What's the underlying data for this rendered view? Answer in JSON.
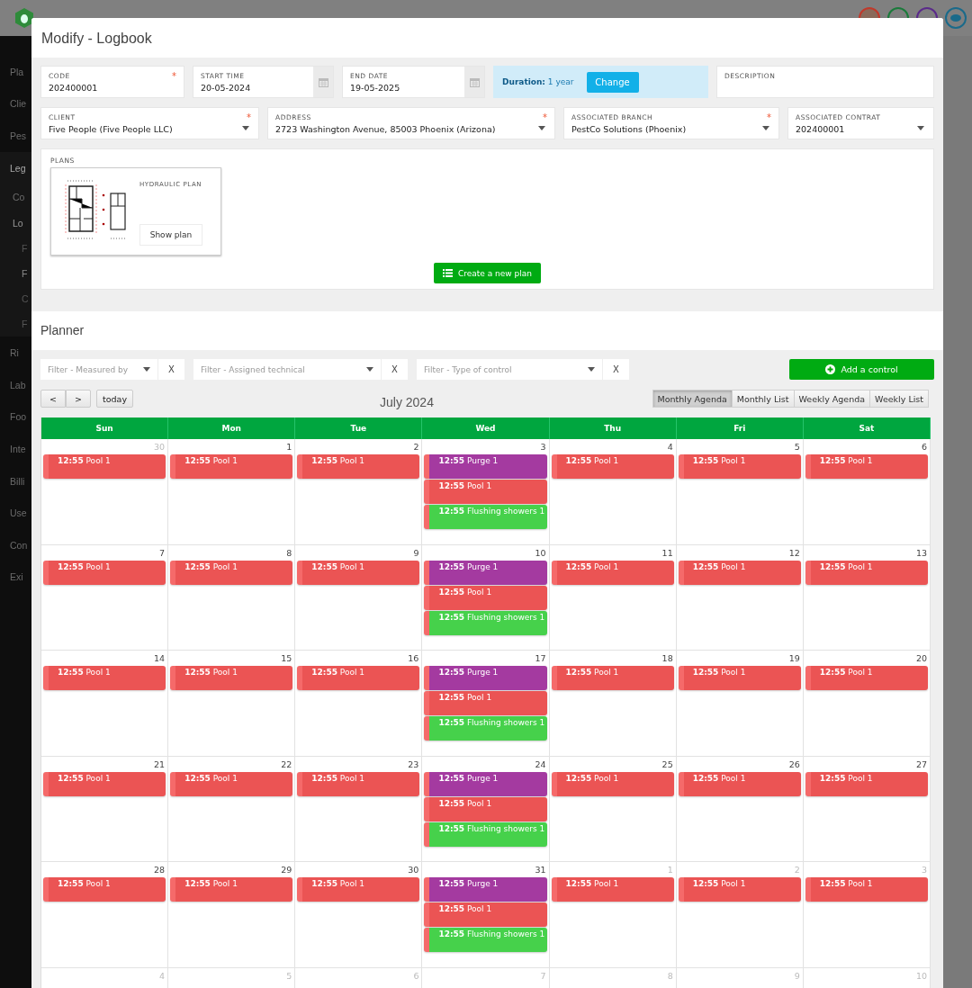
{
  "sidebar": {
    "items": [
      {
        "label": "Pla",
        "selected": false
      },
      {
        "label": "Clie",
        "selected": false
      },
      {
        "label": "Pes",
        "selected": false
      },
      {
        "label": "Leg",
        "selected": true,
        "children": [
          {
            "label": "Co",
            "selected": false
          },
          {
            "label": "Lo",
            "selected": true,
            "children": [
              {
                "label": "F",
                "selected": false
              },
              {
                "label": "F",
                "selected": true
              },
              {
                "label": "C",
                "selected": false
              },
              {
                "label": "F",
                "selected": false
              }
            ]
          }
        ]
      },
      {
        "label": "Ri",
        "selected": false
      },
      {
        "label": "Lab",
        "selected": false
      },
      {
        "label": "Foo",
        "selected": false
      },
      {
        "label": "Inte",
        "selected": false
      },
      {
        "label": "Billi",
        "selected": false
      },
      {
        "label": "Use",
        "selected": false
      },
      {
        "label": "Con",
        "selected": false
      },
      {
        "label": "Exi",
        "selected": false
      }
    ]
  },
  "window": {
    "title": "Modify - Logbook"
  },
  "form": {
    "row_1": [
      {
        "kind": "text",
        "label": "CODE",
        "value": "202400001",
        "required_mark": "*"
      },
      {
        "kind": "date",
        "label": "START TIME",
        "value": "20-05-2024"
      },
      {
        "kind": "date",
        "label": "END DATE",
        "value": "19-05-2025"
      },
      {
        "kind": "duration",
        "label": "Duration:",
        "value": "1 year",
        "button": "Change"
      },
      {
        "kind": "text",
        "label": "DESCRIPTION"
      }
    ],
    "row_2": [
      {
        "kind": "select",
        "label": "CLIENT",
        "value": "Five People (Five People LLC)",
        "required_mark": "*"
      },
      {
        "kind": "select",
        "label": "ADDRESS",
        "value": "2723 Washington Avenue, 85003 Phoenix (Arizona)",
        "required_mark": "*"
      },
      {
        "kind": "select",
        "label": "ASSOCIATED BRANCH",
        "value": "PestCo Solutions (Phoenix)",
        "required_mark": "*"
      },
      {
        "kind": "select",
        "label": "ASSOCIATED CONTRAT",
        "value": "202400001"
      }
    ]
  },
  "plans": {
    "label": "PLANS",
    "items": [
      {
        "title": "HYDRAULIC PLAN",
        "button": "Show plan"
      }
    ],
    "create_button": "Create a new plan"
  },
  "planner": {
    "title": "Planner",
    "filters": [
      {
        "placeholder": "Filter - Measured by",
        "clear": "X"
      },
      {
        "placeholder": "Filter - Assigned technical",
        "clear": "X"
      },
      {
        "placeholder": "Filter - Type of control",
        "clear": "X"
      }
    ],
    "add_button": "Add a control",
    "nav": {
      "prev": "<",
      "next": ">",
      "today": "today"
    },
    "month": "July 2024",
    "views": [
      {
        "label": "Monthly Agenda",
        "selected": true
      },
      {
        "label": "Monthly List",
        "selected": false
      },
      {
        "label": "Weekly Agenda",
        "selected": false
      },
      {
        "label": "Weekly List",
        "selected": false
      }
    ],
    "weekdays": [
      "Sun",
      "Mon",
      "Tue",
      "Wed",
      "Thu",
      "Fri",
      "Sat"
    ],
    "weeks": [
      {
        "days": [
          {
            "date": "30",
            "other_month": true,
            "events": [
              {
                "label": "**12:55** Pool 1",
                "color": "#eb5454"
              }
            ]
          },
          {
            "date": "1",
            "other_month": false,
            "events": [
              {
                "label": "**12:55** Pool 1",
                "color": "#eb5454"
              }
            ]
          },
          {
            "date": "2",
            "other_month": false,
            "events": [
              {
                "label": "**12:55** Pool 1",
                "color": "#eb5454"
              }
            ]
          },
          {
            "date": "3",
            "other_month": false,
            "events": [
              {
                "label": "**12:55** Purge 1",
                "color": "#a43aa0"
              },
              {
                "label": "**12:55** Pool 1",
                "color": "#eb5454"
              },
              {
                "label": "**12:55** Flushing showers 1",
                "color": "#46d14b"
              }
            ]
          },
          {
            "date": "4",
            "other_month": false,
            "events": [
              {
                "label": "**12:55** Pool 1",
                "color": "#eb5454"
              }
            ]
          },
          {
            "date": "5",
            "other_month": false,
            "events": [
              {
                "label": "**12:55** Pool 1",
                "color": "#eb5454"
              }
            ]
          },
          {
            "date": "6",
            "other_month": false,
            "events": [
              {
                "label": "**12:55** Pool 1",
                "color": "#eb5454"
              }
            ]
          }
        ]
      },
      {
        "days": [
          {
            "date": "7",
            "other_month": false,
            "events": [
              {
                "label": "**12:55** Pool 1",
                "color": "#eb5454"
              }
            ]
          },
          {
            "date": "8",
            "other_month": false,
            "events": [
              {
                "label": "**12:55** Pool 1",
                "color": "#eb5454"
              }
            ]
          },
          {
            "date": "9",
            "other_month": false,
            "events": [
              {
                "label": "**12:55** Pool 1",
                "color": "#eb5454"
              }
            ]
          },
          {
            "date": "10",
            "other_month": false,
            "events": [
              {
                "label": "**12:55** Purge 1",
                "color": "#a43aa0"
              },
              {
                "label": "**12:55** Pool 1",
                "color": "#eb5454"
              },
              {
                "label": "**12:55** Flushing showers 1",
                "color": "#46d14b"
              }
            ]
          },
          {
            "date": "11",
            "other_month": false,
            "events": [
              {
                "label": "**12:55** Pool 1",
                "color": "#eb5454"
              }
            ]
          },
          {
            "date": "12",
            "other_month": false,
            "events": [
              {
                "label": "**12:55** Pool 1",
                "color": "#eb5454"
              }
            ]
          },
          {
            "date": "13",
            "other_month": false,
            "events": [
              {
                "label": "**12:55** Pool 1",
                "color": "#eb5454"
              }
            ]
          }
        ]
      },
      {
        "days": [
          {
            "date": "14",
            "other_month": false,
            "events": [
              {
                "label": "**12:55** Pool 1",
                "color": "#eb5454"
              }
            ]
          },
          {
            "date": "15",
            "other_month": false,
            "events": [
              {
                "label": "**12:55** Pool 1",
                "color": "#eb5454"
              }
            ]
          },
          {
            "date": "16",
            "other_month": false,
            "events": [
              {
                "label": "**12:55** Pool 1",
                "color": "#eb5454"
              }
            ]
          },
          {
            "date": "17",
            "other_month": false,
            "events": [
              {
                "label": "**12:55** Purge 1",
                "color": "#a43aa0"
              },
              {
                "label": "**12:55** Pool 1",
                "color": "#eb5454"
              },
              {
                "label": "**12:55** Flushing showers 1",
                "color": "#46d14b"
              }
            ]
          },
          {
            "date": "18",
            "other_month": false,
            "events": [
              {
                "label": "**12:55** Pool 1",
                "color": "#eb5454"
              }
            ]
          },
          {
            "date": "19",
            "other_month": false,
            "events": [
              {
                "label": "**12:55** Pool 1",
                "color": "#eb5454"
              }
            ]
          },
          {
            "date": "20",
            "other_month": false,
            "events": [
              {
                "label": "**12:55** Pool 1",
                "color": "#eb5454"
              }
            ]
          }
        ]
      },
      {
        "days": [
          {
            "date": "21",
            "other_month": false,
            "events": [
              {
                "label": "**12:55** Pool 1",
                "color": "#eb5454"
              }
            ]
          },
          {
            "date": "22",
            "other_month": false,
            "events": [
              {
                "label": "**12:55** Pool 1",
                "color": "#eb5454"
              }
            ]
          },
          {
            "date": "23",
            "other_month": false,
            "events": [
              {
                "label": "**12:55** Pool 1",
                "color": "#eb5454"
              }
            ]
          },
          {
            "date": "24",
            "other_month": false,
            "events": [
              {
                "label": "**12:55** Purge 1",
                "color": "#a43aa0"
              },
              {
                "label": "**12:55** Pool 1",
                "color": "#eb5454"
              },
              {
                "label": "**12:55** Flushing showers 1",
                "color": "#46d14b"
              }
            ]
          },
          {
            "date": "25",
            "other_month": false,
            "events": [
              {
                "label": "**12:55** Pool 1",
                "color": "#eb5454"
              }
            ]
          },
          {
            "date": "26",
            "other_month": false,
            "events": [
              {
                "label": "**12:55** Pool 1",
                "color": "#eb5454"
              }
            ]
          },
          {
            "date": "27",
            "other_month": false,
            "events": [
              {
                "label": "**12:55** Pool 1",
                "color": "#eb5454"
              }
            ]
          }
        ]
      },
      {
        "days": [
          {
            "date": "28",
            "other_month": false,
            "events": [
              {
                "label": "**12:55** Pool 1",
                "color": "#eb5454"
              }
            ]
          },
          {
            "date": "29",
            "other_month": false,
            "events": [
              {
                "label": "**12:55** Pool 1",
                "color": "#eb5454"
              }
            ]
          },
          {
            "date": "30",
            "other_month": false,
            "events": [
              {
                "label": "**12:55** Pool 1",
                "color": "#eb5454"
              }
            ]
          },
          {
            "date": "31",
            "other_month": false,
            "events": [
              {
                "label": "**12:55** Purge 1",
                "color": "#a43aa0"
              },
              {
                "label": "**12:55** Pool 1",
                "color": "#eb5454"
              },
              {
                "label": "**12:55** Flushing showers 1",
                "color": "#46d14b"
              }
            ]
          },
          {
            "date": "1",
            "other_month": true,
            "events": [
              {
                "label": "**12:55** Pool 1",
                "color": "#eb5454"
              }
            ]
          },
          {
            "date": "2",
            "other_month": true,
            "events": [
              {
                "label": "**12:55** Pool 1",
                "color": "#eb5454"
              }
            ]
          },
          {
            "date": "3",
            "other_month": true,
            "events": [
              {
                "label": "**12:55** Pool 1",
                "color": "#eb5454"
              }
            ]
          }
        ]
      },
      {
        "days": [
          {
            "date": "4",
            "other_month": true
          },
          {
            "date": "5",
            "other_month": true
          },
          {
            "date": "6",
            "other_month": true
          },
          {
            "date": "7",
            "other_month": true
          },
          {
            "date": "8",
            "other_month": true
          },
          {
            "date": "9",
            "other_month": true
          },
          {
            "date": "10",
            "other_month": true
          }
        ]
      }
    ]
  }
}
